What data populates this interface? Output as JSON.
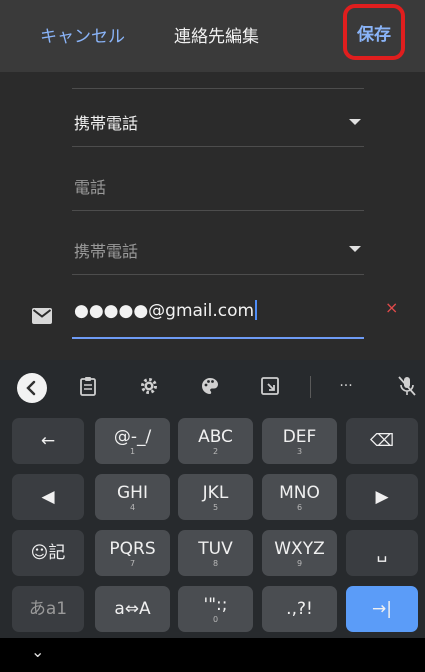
{
  "header": {
    "cancel_label": "キャンセル",
    "title": "連絡先編集",
    "save_label": "保存",
    "highlight_color": "#e01e1e"
  },
  "form": {
    "phone_type_1": "携帯電話",
    "phone_placeholder": "電話",
    "phone_type_2": "携帯電話",
    "email_value": "●●●●●@gmail.com",
    "clear_symbol": "×"
  },
  "keyboard": {
    "toolbar": [
      "back",
      "clipboard",
      "settings",
      "theme",
      "resize",
      "more",
      "voice-off"
    ],
    "more_label": "···",
    "rows": [
      [
        {
          "main": "←",
          "sub": "",
          "name": "undo"
        },
        {
          "main": "@-_/",
          "sub": "1",
          "name": "key-1"
        },
        {
          "main": "ABC",
          "sub": "2",
          "name": "key-2"
        },
        {
          "main": "DEF",
          "sub": "3",
          "name": "key-3"
        },
        {
          "main": "⌫",
          "sub": "",
          "name": "backspace"
        }
      ],
      [
        {
          "main": "◀",
          "sub": "",
          "name": "cursor-left"
        },
        {
          "main": "GHI",
          "sub": "4",
          "name": "key-4"
        },
        {
          "main": "JKL",
          "sub": "5",
          "name": "key-5"
        },
        {
          "main": "MNO",
          "sub": "6",
          "name": "key-6"
        },
        {
          "main": "▶",
          "sub": "",
          "name": "cursor-right"
        }
      ],
      [
        {
          "main": "☺記",
          "sub": "",
          "name": "emoji-symbol"
        },
        {
          "main": "PQRS",
          "sub": "7",
          "name": "key-7"
        },
        {
          "main": "TUV",
          "sub": "8",
          "name": "key-8"
        },
        {
          "main": "WXYZ",
          "sub": "9",
          "name": "key-9"
        },
        {
          "main": "␣",
          "sub": "",
          "name": "space"
        }
      ],
      [
        {
          "main": "あa1",
          "sub": "",
          "name": "mode-switch"
        },
        {
          "main": "a⇔A",
          "sub": "",
          "name": "case-toggle"
        },
        {
          "main": "'\":;",
          "sub": "0",
          "name": "key-0"
        },
        {
          "main": ".,?!",
          "sub": "",
          "name": "punctuation"
        },
        {
          "main": "→|",
          "sub": "",
          "name": "next"
        }
      ]
    ]
  },
  "nav": {
    "chevron": "⌄"
  }
}
